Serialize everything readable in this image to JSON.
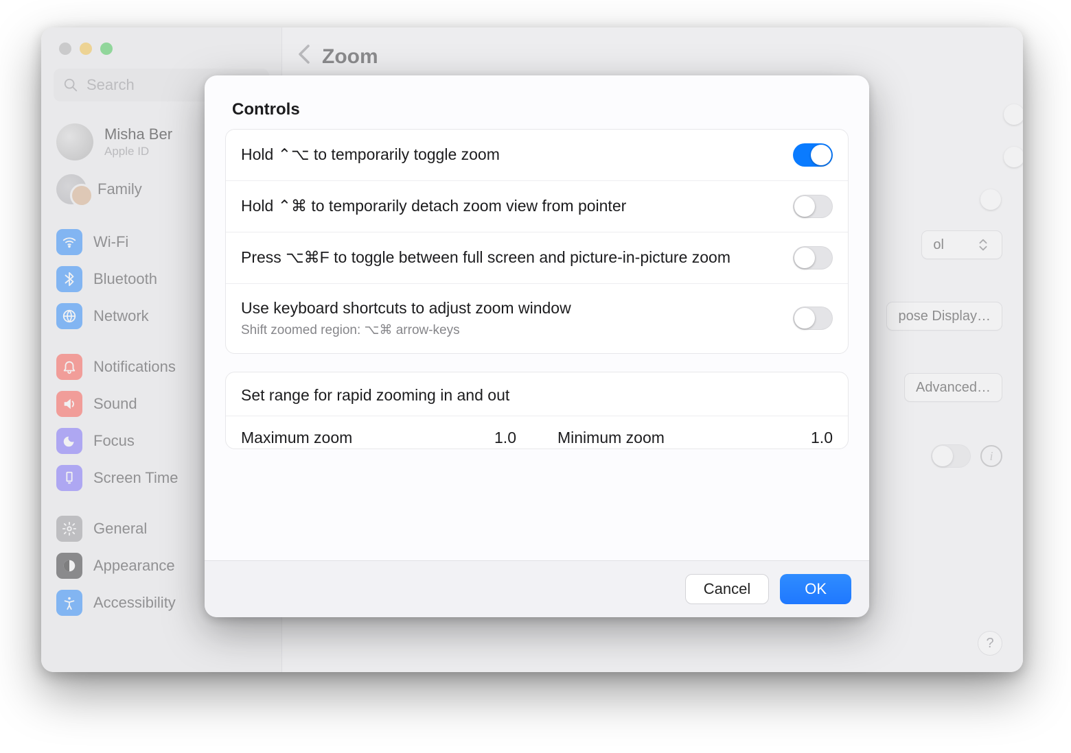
{
  "window": {
    "title": "Zoom",
    "searchPlaceholder": "Search"
  },
  "profile": {
    "name": "Misha Ber",
    "sub": "Apple ID"
  },
  "sidebar": {
    "family": "Family",
    "items1": [
      {
        "label": "Wi-Fi",
        "iconName": "wifi-icon",
        "color": "#0a7bff"
      },
      {
        "label": "Bluetooth",
        "iconName": "bluetooth-icon",
        "color": "#0a7bff"
      },
      {
        "label": "Network",
        "iconName": "network-icon",
        "color": "#0a7bff"
      }
    ],
    "items2": [
      {
        "label": "Notifications",
        "iconName": "bell-icon",
        "color": "#ff453a"
      },
      {
        "label": "Sound",
        "iconName": "sound-icon",
        "color": "#ff453a"
      },
      {
        "label": "Focus",
        "iconName": "focus-icon",
        "color": "#6a5cff"
      },
      {
        "label": "Screen Time",
        "iconName": "screentime-icon",
        "color": "#6a5cff"
      }
    ],
    "items3": [
      {
        "label": "General",
        "iconName": "gear-icon",
        "color": "#8e8e93"
      },
      {
        "label": "Appearance",
        "iconName": "appearance-icon",
        "color": "#1c1c1e"
      },
      {
        "label": "Accessibility",
        "iconName": "accessibility-icon",
        "color": "#0a7bff"
      }
    ]
  },
  "bgControls": {
    "selectSuffix": "ol",
    "chooseDisplay": "pose Display…",
    "advanced": "Advanced…"
  },
  "sheet": {
    "section": "Controls",
    "rows": [
      {
        "label": "Hold ⌃⌥ to temporarily toggle zoom",
        "sub": "",
        "on": true
      },
      {
        "label": "Hold ⌃⌘ to temporarily detach zoom view from pointer",
        "sub": "",
        "on": false
      },
      {
        "label": "Press ⌥⌘F to toggle between full screen and picture-in-picture zoom",
        "sub": "",
        "on": false
      },
      {
        "label": "Use keyboard shortcuts to adjust zoom window",
        "sub": "Shift zoomed region: ⌥⌘ arrow-keys",
        "on": false
      }
    ],
    "rangeHeader": "Set range for rapid zooming in and out",
    "maxLabel": "Maximum zoom",
    "maxValue": "1.0",
    "minLabel": "Minimum zoom",
    "minValue": "1.0",
    "cancel": "Cancel",
    "ok": "OK"
  }
}
